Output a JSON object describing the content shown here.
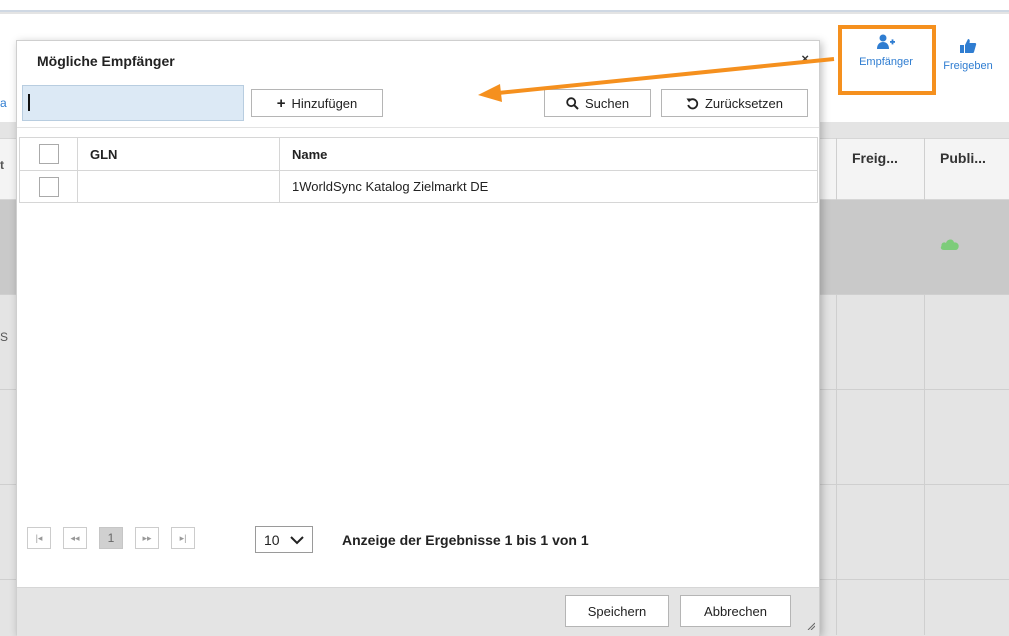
{
  "toolbar": {
    "recipients_label": "Empfänger",
    "release_label": "Freigeben",
    "highlight_color": "#f5901e",
    "accent_color": "#2f7dd1"
  },
  "background_grid": {
    "columns": [
      "Freig...",
      "Publi..."
    ],
    "left_fragments": [
      "a",
      "t",
      "S"
    ]
  },
  "dialog": {
    "title": "Mögliche Empfänger",
    "close_symbol": "×",
    "search": {
      "value": "",
      "placeholder": ""
    },
    "add_label": "Hinzufügen",
    "search_label": "Suchen",
    "reset_label": "Zurücksetzen",
    "table": {
      "headers": [
        "GLN",
        "Name"
      ],
      "rows": [
        {
          "gln": "",
          "name": "1WorldSync Katalog Zielmarkt DE"
        }
      ]
    },
    "pager": {
      "first": "|◂",
      "prev": "◂◂",
      "current_page": "1",
      "next": "▸▸",
      "last": "▸|",
      "page_size": "10",
      "info": "Anzeige der Ergebnisse 1 bis 1 von 1"
    },
    "save_label": "Speichern",
    "cancel_label": "Abbrechen"
  },
  "icons": {
    "add": "plus-icon",
    "search": "search-icon",
    "reset": "undo-icon",
    "recipients": "add-user-icon",
    "release": "thumbs-up-icon",
    "status": "cloud-icon"
  }
}
